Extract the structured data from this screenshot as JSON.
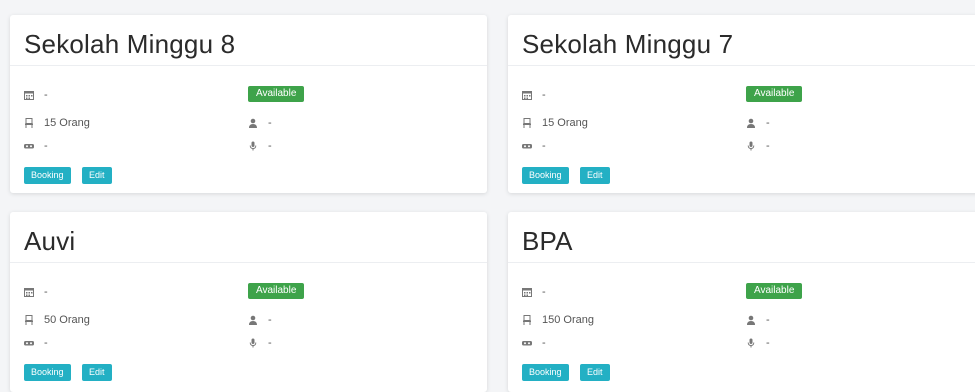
{
  "cards": [
    {
      "title": "Sekolah Minggu 8",
      "schedule": "-",
      "status": "Available",
      "capacity": "15 Orang",
      "person": "-",
      "vr": "-",
      "mic": "-",
      "booking_label": "Booking",
      "edit_label": "Edit"
    },
    {
      "title": "Sekolah Minggu 7",
      "schedule": "-",
      "status": "Available",
      "capacity": "15 Orang",
      "person": "-",
      "vr": "-",
      "mic": "-",
      "booking_label": "Booking",
      "edit_label": "Edit"
    },
    {
      "title": "Auvi",
      "schedule": "-",
      "status": "Available",
      "capacity": "50 Orang",
      "person": "-",
      "vr": "-",
      "mic": "-",
      "booking_label": "Booking",
      "edit_label": "Edit"
    },
    {
      "title": "BPA",
      "schedule": "-",
      "status": "Available",
      "capacity": "150 Orang",
      "person": "-",
      "vr": "-",
      "mic": "-",
      "booking_label": "Booking",
      "edit_label": "Edit"
    }
  ],
  "icons": {
    "schedule": "calendar-icon",
    "capacity": "chair-icon",
    "vr": "vr-headset-icon",
    "person": "user-icon",
    "mic": "microphone-icon"
  },
  "colors": {
    "available_badge": "#3ea34a",
    "action_button": "#23b0c4"
  }
}
